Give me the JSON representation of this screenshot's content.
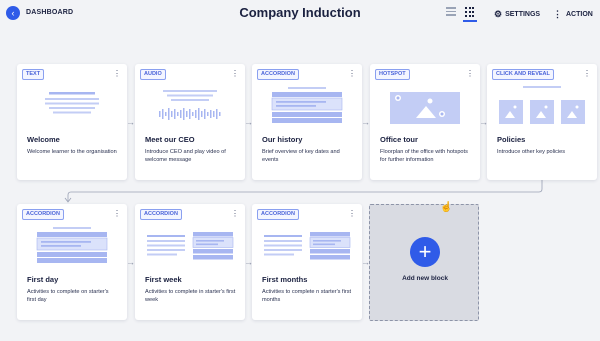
{
  "header": {
    "back_icon": "chevron-left-icon",
    "dashboard_label": "DASHBOARD",
    "title": "Company Induction",
    "settings_label": "SETTINGS",
    "action_label": "ACTION"
  },
  "colors": {
    "accent": "#2f5be8",
    "tag_border": "#8aa0f0",
    "thumb_blue": "#a7b6f1",
    "background": "#f2f3f6"
  },
  "blocks": [
    {
      "tag": "TEXT",
      "title": "Welcome",
      "desc": "Welcome learner to the organisation",
      "thumb": "text-thumbnail"
    },
    {
      "tag": "AUDIO",
      "title": "Meet our CEO",
      "desc": "Introduce CEO and play video of welcome message",
      "thumb": "audio-thumbnail"
    },
    {
      "tag": "ACCORDION",
      "title": "Our history",
      "desc": "Brief overview of key dates and events",
      "thumb": "accordion-thumbnail"
    },
    {
      "tag": "HOTSPOT",
      "title": "Office tour",
      "desc": "Floorplan of the office with hotspots for further information",
      "thumb": "hotspot-thumbnail"
    },
    {
      "tag": "CLICK AND REVEAL",
      "title": "Policies",
      "desc": "Introduce other key policies",
      "thumb": "click-reveal-thumbnail"
    },
    {
      "tag": "ACCORDION",
      "title": "First day",
      "desc": "Activities to complete on starter's first day",
      "thumb": "accordion-thumbnail"
    },
    {
      "tag": "ACCORDION",
      "title": "First week",
      "desc": "Activities to complete in starter's first week",
      "thumb": "accordion-thumbnail"
    },
    {
      "tag": "ACCORDION",
      "title": "First months",
      "desc": "Activities to complete n starter's first months",
      "thumb": "accordion-thumbnail"
    }
  ],
  "add_block": {
    "label": "Add new block",
    "icon": "plus-icon"
  }
}
